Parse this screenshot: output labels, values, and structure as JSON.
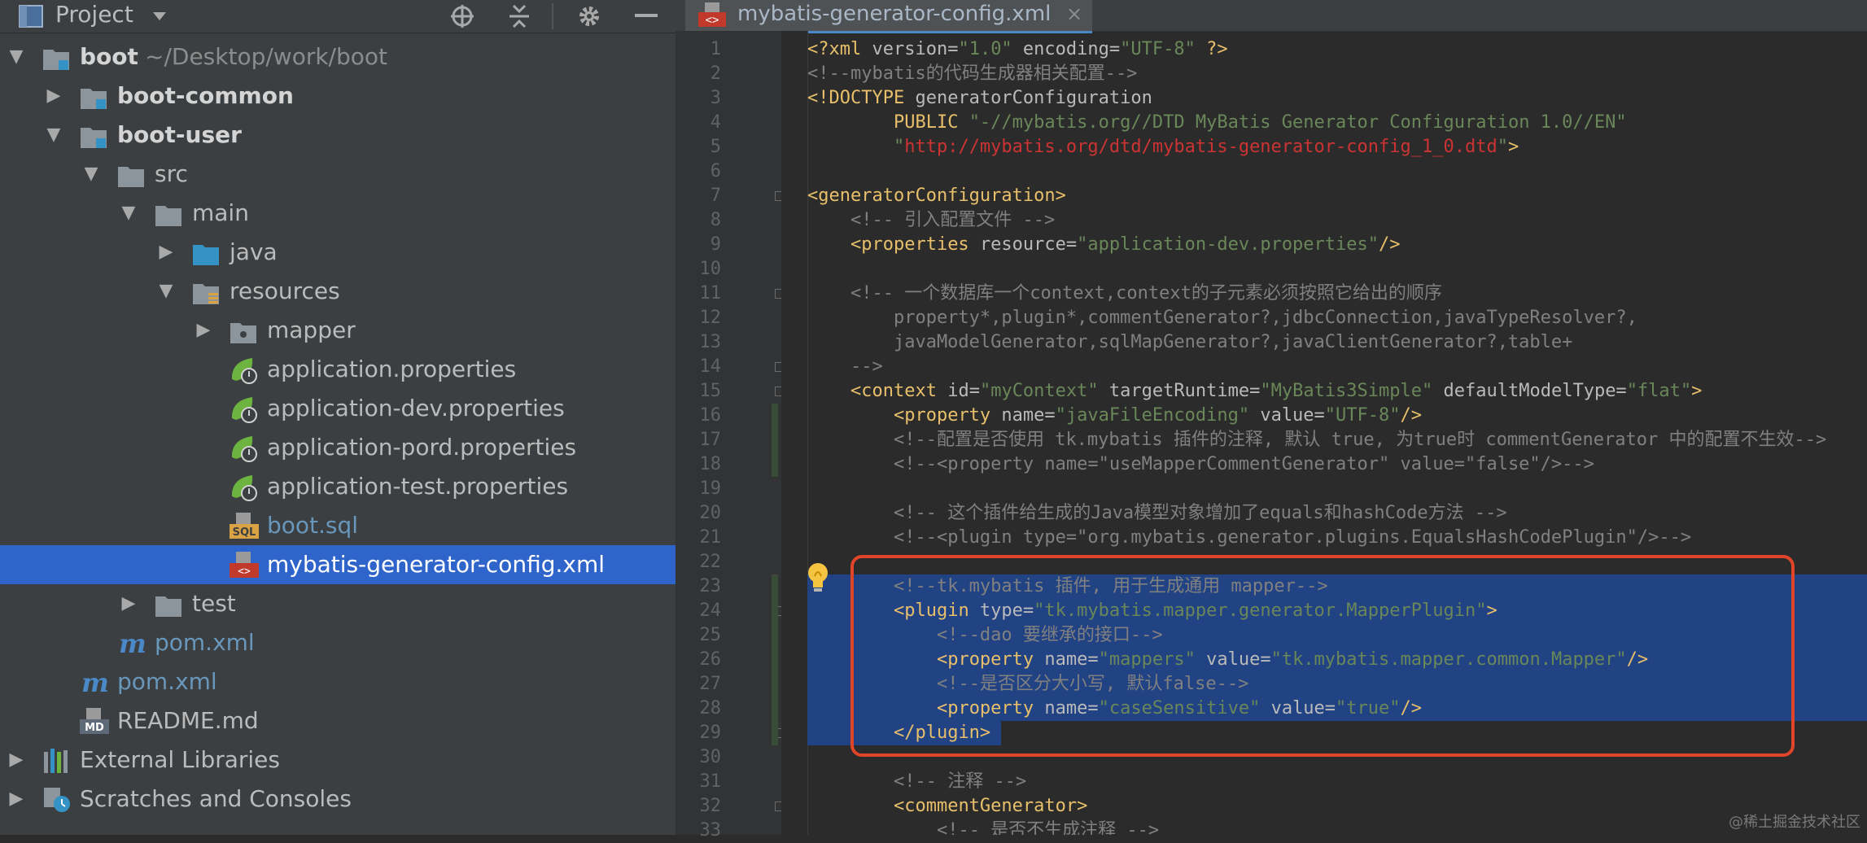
{
  "project_panel": {
    "title": "Project",
    "tree": [
      {
        "label": "boot",
        "hint": "~/Desktop/work/boot",
        "indent": 0,
        "arrow": "down",
        "icon": "module-folder-icon",
        "style": "bold"
      },
      {
        "label": "boot-common",
        "indent": 1,
        "arrow": "right",
        "icon": "module-folder-icon",
        "style": "bold"
      },
      {
        "label": "boot-user",
        "indent": 1,
        "arrow": "down",
        "icon": "module-folder-icon",
        "style": "bold"
      },
      {
        "label": "src",
        "indent": 2,
        "arrow": "down",
        "icon": "folder-icon",
        "style": "normal"
      },
      {
        "label": "main",
        "indent": 3,
        "arrow": "down",
        "icon": "folder-icon",
        "style": "normal"
      },
      {
        "label": "java",
        "indent": 4,
        "arrow": "right",
        "icon": "source-folder-icon",
        "style": "normal"
      },
      {
        "label": "resources",
        "indent": 4,
        "arrow": "down",
        "icon": "resources-folder-icon",
        "style": "normal"
      },
      {
        "label": "mapper",
        "indent": 5,
        "arrow": "right",
        "icon": "package-folder-icon",
        "style": "normal"
      },
      {
        "label": "application.properties",
        "indent": 5,
        "arrow": "",
        "icon": "spring-properties-icon",
        "style": "normal"
      },
      {
        "label": "application-dev.properties",
        "indent": 5,
        "arrow": "",
        "icon": "spring-properties-icon",
        "style": "normal"
      },
      {
        "label": "application-pord.properties",
        "indent": 5,
        "arrow": "",
        "icon": "spring-properties-icon",
        "style": "normal"
      },
      {
        "label": "application-test.properties",
        "indent": 5,
        "arrow": "",
        "icon": "spring-properties-icon",
        "style": "normal"
      },
      {
        "label": "boot.sql",
        "indent": 5,
        "arrow": "",
        "icon": "sql-file-icon",
        "style": "blue"
      },
      {
        "label": "mybatis-generator-config.xml",
        "indent": 5,
        "arrow": "",
        "icon": "xml-file-icon",
        "style": "selected"
      },
      {
        "label": "test",
        "indent": 3,
        "arrow": "right",
        "icon": "folder-icon",
        "style": "normal"
      },
      {
        "label": "pom.xml",
        "indent": 2,
        "arrow": "",
        "icon": "maven-icon",
        "style": "blue"
      },
      {
        "label": "pom.xml",
        "indent": 1,
        "arrow": "",
        "icon": "maven-icon",
        "style": "blue"
      },
      {
        "label": "README.md",
        "indent": 1,
        "arrow": "",
        "icon": "markdown-file-icon",
        "style": "normal"
      },
      {
        "label": "External Libraries",
        "indent": 0,
        "arrow": "right",
        "icon": "libraries-icon",
        "style": "normal"
      },
      {
        "label": "Scratches and Consoles",
        "indent": 0,
        "arrow": "right",
        "icon": "scratches-icon",
        "style": "normal"
      }
    ]
  },
  "editor": {
    "tab_label": "mybatis-generator-config.xml",
    "tab_close": "×",
    "lines": [
      [
        [
          "t",
          "<?xml "
        ],
        [
          "a",
          "version="
        ],
        [
          "s",
          "\"1.0\""
        ],
        [
          "a",
          " encoding="
        ],
        [
          "s",
          "\"UTF-8\""
        ],
        [
          "t",
          " ?>"
        ]
      ],
      [
        [
          "c",
          "<!--mybatis的代码生成器相关配置-->"
        ]
      ],
      [
        [
          "t",
          "<!DOCTYPE "
        ],
        [
          "a",
          "generatorConfiguration"
        ]
      ],
      [
        [
          "a",
          "        "
        ],
        [
          "t",
          "PUBLIC "
        ],
        [
          "s",
          "\"-//mybatis.org//DTD MyBatis Generator Configuration 1.0//EN\""
        ]
      ],
      [
        [
          "a",
          "        "
        ],
        [
          "s",
          "\""
        ],
        [
          "u",
          "http://mybatis.org/dtd/mybatis-generator-config_1_0.dtd"
        ],
        [
          "s",
          "\""
        ],
        [
          "t",
          ">"
        ]
      ],
      [],
      [
        [
          "t",
          "<generatorConfiguration>"
        ]
      ],
      [
        [
          "a",
          "    "
        ],
        [
          "c",
          "<!-- 引入配置文件 -->"
        ]
      ],
      [
        [
          "a",
          "    "
        ],
        [
          "t",
          "<properties "
        ],
        [
          "a",
          "resource="
        ],
        [
          "s",
          "\"application-dev.properties\""
        ],
        [
          "t",
          "/>"
        ]
      ],
      [],
      [
        [
          "a",
          "    "
        ],
        [
          "c",
          "<!-- 一个数据库一个context,context的子元素必须按照它给出的顺序"
        ]
      ],
      [
        [
          "c",
          "        property*,plugin*,commentGenerator?,jdbcConnection,javaTypeResolver?,"
        ]
      ],
      [
        [
          "c",
          "        javaModelGenerator,sqlMapGenerator?,javaClientGenerator?,table+"
        ]
      ],
      [
        [
          "c",
          "    -->"
        ]
      ],
      [
        [
          "a",
          "    "
        ],
        [
          "t",
          "<context "
        ],
        [
          "a",
          "id="
        ],
        [
          "s",
          "\"myContext\""
        ],
        [
          "a",
          " targetRuntime="
        ],
        [
          "s",
          "\"MyBatis3Simple\""
        ],
        [
          "a",
          " defaultModelType="
        ],
        [
          "s",
          "\"flat\""
        ],
        [
          "t",
          ">"
        ]
      ],
      [
        [
          "a",
          "        "
        ],
        [
          "t",
          "<property "
        ],
        [
          "a",
          "name="
        ],
        [
          "s",
          "\"javaFileEncoding\""
        ],
        [
          "a",
          " value="
        ],
        [
          "s",
          "\"UTF-8\""
        ],
        [
          "t",
          "/>"
        ]
      ],
      [
        [
          "a",
          "        "
        ],
        [
          "c",
          "<!--配置是否使用 tk.mybatis 插件的注释, 默认 true, 为true时 commentGenerator 中的配置不生效-->"
        ]
      ],
      [
        [
          "a",
          "        "
        ],
        [
          "c",
          "<!--<property name=\"useMapperCommentGenerator\" value=\"false\"/>-->"
        ]
      ],
      [],
      [
        [
          "a",
          "        "
        ],
        [
          "c",
          "<!-- 这个插件给生成的Java模型对象增加了equals和hashCode方法 -->"
        ]
      ],
      [
        [
          "a",
          "        "
        ],
        [
          "c",
          "<!--<plugin type=\"org.mybatis.generator.plugins.EqualsHashCodePlugin\"/>-->"
        ]
      ],
      [],
      [
        [
          "a",
          "        "
        ],
        [
          "c",
          "<!--tk.mybatis 插件, 用于生成通用 mapper-->"
        ]
      ],
      [
        [
          "a",
          "        "
        ],
        [
          "t",
          "<plugin "
        ],
        [
          "a",
          "type="
        ],
        [
          "s",
          "\"tk.mybatis.mapper.generator.MapperPlugin\""
        ],
        [
          "t",
          ">"
        ]
      ],
      [
        [
          "a",
          "            "
        ],
        [
          "c",
          "<!--dao 要继承的接口-->"
        ]
      ],
      [
        [
          "a",
          "            "
        ],
        [
          "t",
          "<property "
        ],
        [
          "a",
          "name="
        ],
        [
          "s",
          "\"mappers\""
        ],
        [
          "a",
          " value="
        ],
        [
          "s",
          "\"tk.mybatis.mapper.common.Mapper\""
        ],
        [
          "t",
          "/>"
        ]
      ],
      [
        [
          "a",
          "            "
        ],
        [
          "c",
          "<!--是否区分大小写, 默认false-->"
        ]
      ],
      [
        [
          "a",
          "            "
        ],
        [
          "t",
          "<property "
        ],
        [
          "a",
          "name="
        ],
        [
          "s",
          "\"caseSensitive\""
        ],
        [
          "a",
          " value="
        ],
        [
          "s",
          "\"true\""
        ],
        [
          "t",
          "/>"
        ]
      ],
      [
        [
          "a",
          "        "
        ],
        [
          "t",
          "</plugin>"
        ]
      ],
      [],
      [
        [
          "a",
          "        "
        ],
        [
          "c",
          "<!-- 注释 -->"
        ]
      ],
      [
        [
          "a",
          "        "
        ],
        [
          "t",
          "<commentGenerator>"
        ]
      ],
      [
        [
          "a",
          "            "
        ],
        [
          "c",
          "<!-- 是否不生成注释 -->"
        ]
      ]
    ],
    "fold_lines": [
      7,
      11,
      14,
      15,
      24,
      29,
      32
    ],
    "selected_lines": [
      23,
      29
    ]
  },
  "watermark": "@稀土掘金技术社区",
  "colors": {
    "panel_bg": "#3c3f41",
    "editor_bg": "#2b2b2b",
    "selection_tree": "#2f65ca",
    "selection_code": "#214283",
    "highlight_box": "#e0452a"
  }
}
